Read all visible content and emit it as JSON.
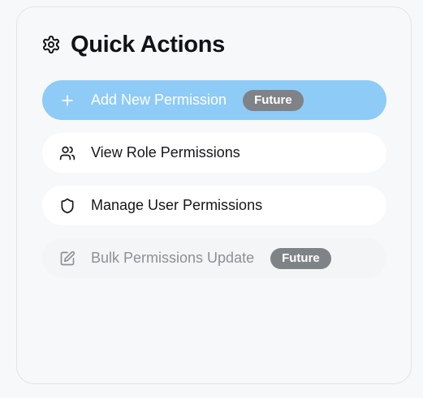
{
  "panel": {
    "title": "Quick Actions",
    "title_icon": "gear-icon"
  },
  "actions": [
    {
      "label": "Add New Permission",
      "icon": "plus-icon",
      "badge": "Future",
      "state": "primary"
    },
    {
      "label": "View Role Permissions",
      "icon": "users-icon",
      "state": "default"
    },
    {
      "label": "Manage User Permissions",
      "icon": "shield-icon",
      "state": "default"
    },
    {
      "label": "Bulk Permissions Update",
      "icon": "edit-icon",
      "badge": "Future",
      "state": "disabled"
    }
  ],
  "colors": {
    "primary": "#8ecbf7",
    "badge": "#7f8287",
    "background": "#f7f8f9"
  }
}
